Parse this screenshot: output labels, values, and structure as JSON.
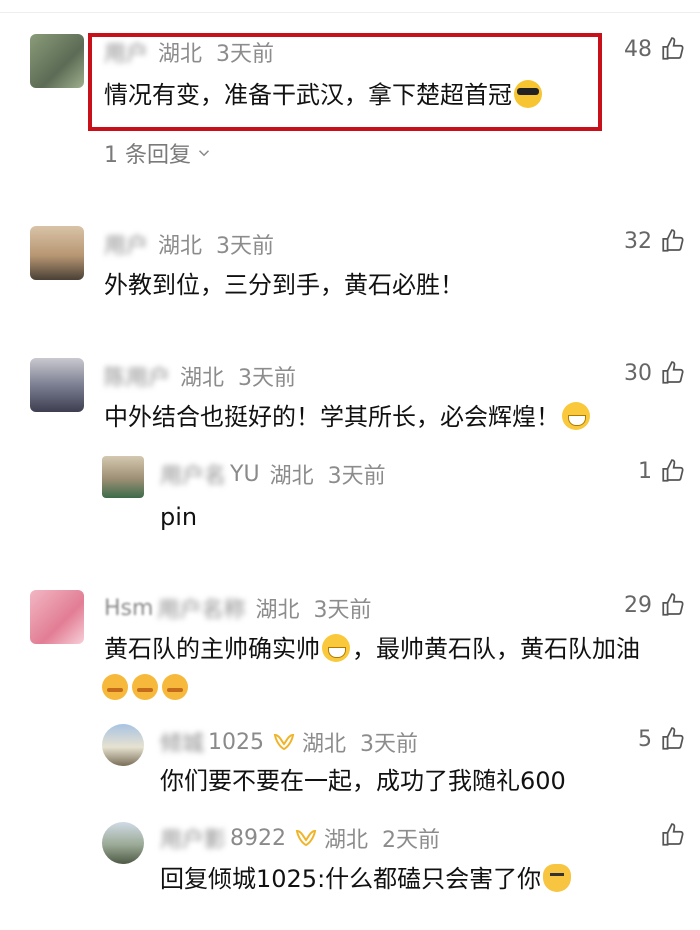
{
  "comments": [
    {
      "user": "用户",
      "location": "湖北",
      "time": "3天前",
      "likes": "48",
      "text": "情况有变，准备干武汉，拿下楚超首冠",
      "replies": "1 条回复"
    },
    {
      "user": "用户",
      "location": "湖北",
      "time": "3天前",
      "likes": "32",
      "text": "外教到位，三分到手，黄石必胜！"
    },
    {
      "user": "陈用户",
      "location": "湖北",
      "time": "3天前",
      "likes": "30",
      "text": "中外结合也挺好的！学其所长，必会辉煌！",
      "reply": {
        "user_tail": "YU",
        "location": "湖北",
        "time": "3天前",
        "likes": "1",
        "text": "pin"
      }
    },
    {
      "user": "Hsm",
      "location": "湖北",
      "time": "3天前",
      "likes": "29",
      "text_a": "黄石队的主帅确实帅",
      "text_b": "，最帅黄石队，黄石队加油",
      "replies_list": [
        {
          "user_tail": "1025",
          "location": "湖北",
          "time": "3天前",
          "likes": "5",
          "text": "你们要不要在一起，成功了我随礼600"
        },
        {
          "user_tail": "8922",
          "location": "湖北",
          "time": "2天前",
          "likes": "",
          "text": "回复倾城1025:什么都磕只会害了你"
        }
      ]
    }
  ],
  "icons": {
    "like": "thumbs-up-icon",
    "expand": "chevron-down-icon",
    "badge": "yellow-ribbon-badge-icon"
  },
  "colors": {
    "highlight": "#c8101a",
    "meta": "#8c8c8c",
    "text": "#111111"
  }
}
